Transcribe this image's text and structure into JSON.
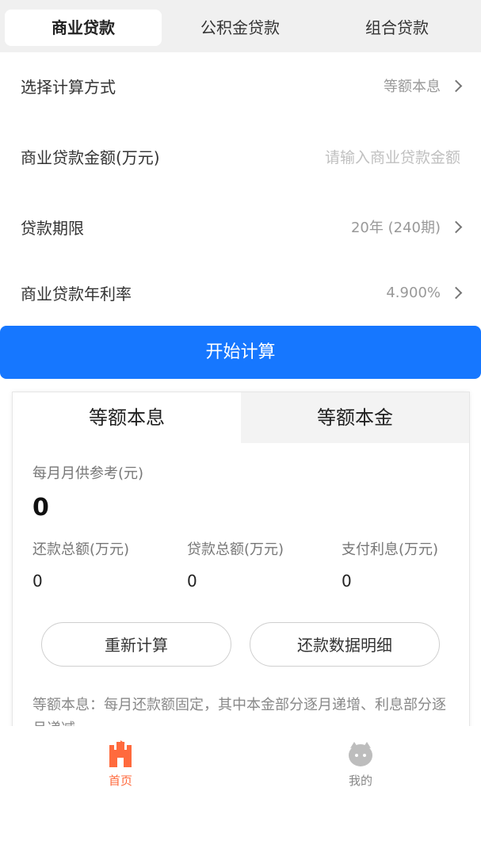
{
  "tabs": [
    {
      "label": "商业贷款",
      "active": true
    },
    {
      "label": "公积金贷款",
      "active": false
    },
    {
      "label": "组合贷款",
      "active": false
    }
  ],
  "form": {
    "method": {
      "label": "选择计算方式",
      "value": "等额本息"
    },
    "amount": {
      "label": "商业贷款金额(万元)",
      "placeholder": "请输入商业贷款金额"
    },
    "term": {
      "label": "贷款期限",
      "value": "20年 (240期)"
    },
    "rate": {
      "label": "商业贷款年利率",
      "value": "4.900%"
    }
  },
  "calc_button": "开始计算",
  "result": {
    "tabs": [
      {
        "label": "等额本息",
        "active": true
      },
      {
        "label": "等额本金",
        "active": false
      }
    ],
    "monthly_label": "每月月供参考(元)",
    "monthly_value": "0",
    "stats": [
      {
        "label": "还款总额(万元)",
        "value": "0"
      },
      {
        "label": "贷款总额(万元)",
        "value": "0"
      },
      {
        "label": "支付利息(万元)",
        "value": "0"
      }
    ],
    "recalc_button": "重新计算",
    "detail_button": "还款数据明细",
    "description": "等额本息：每月还款额固定，其中本金部分逐月递增、利息部分逐月递减"
  },
  "nav": [
    {
      "label": "首页",
      "icon": "castle-icon",
      "active": true
    },
    {
      "label": "我的",
      "icon": "profile-icon",
      "active": false
    }
  ],
  "colors": {
    "primary": "#1677ff",
    "nav_active": "#ff6a3d",
    "nav_inactive": "#888888"
  }
}
